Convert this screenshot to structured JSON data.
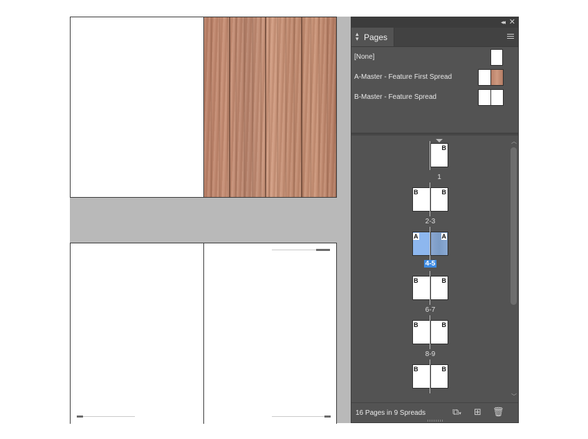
{
  "panel": {
    "tab_label": "Pages",
    "masters": [
      {
        "label": "[None]"
      },
      {
        "label": "A-Master - Feature First Spread"
      },
      {
        "label": "B-Master - Feature Spread"
      }
    ],
    "spreads": [
      {
        "label": "1",
        "left": "",
        "right": "B",
        "selected": false
      },
      {
        "label": "2-3",
        "left": "B",
        "right": "B",
        "selected": false
      },
      {
        "label": "4-5",
        "left": "A",
        "right": "A",
        "selected": true
      },
      {
        "label": "6-7",
        "left": "B",
        "right": "B",
        "selected": false
      },
      {
        "label": "8-9",
        "left": "B",
        "right": "B",
        "selected": false
      },
      {
        "label": "",
        "left": "B",
        "right": "B",
        "selected": false
      }
    ],
    "footer_status": "16 Pages in 9 Spreads",
    "icons": {
      "collapse": "collapse-icon",
      "close": "close-icon",
      "menu": "panel-menu-icon",
      "edit_page_size": "edit-page-size-icon",
      "new_page": "new-page-icon",
      "delete": "trash-icon"
    },
    "colors": {
      "panel_bg": "#535353",
      "selection": "#3d8be3",
      "selected_page": "#8db7ef"
    }
  }
}
